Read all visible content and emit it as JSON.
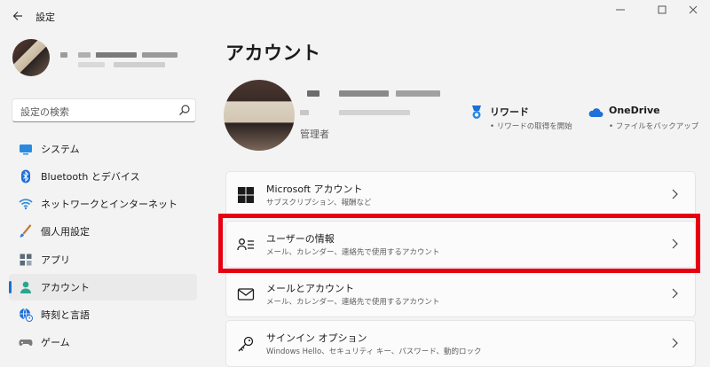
{
  "window": {
    "title": "設定",
    "back_icon": "arrow-left-icon",
    "controls": [
      "minimize-icon",
      "maximize-icon",
      "close-icon"
    ]
  },
  "sidebar": {
    "search": {
      "placeholder": "設定の検索",
      "icon": "search-icon"
    },
    "items": [
      {
        "label": "システム",
        "icon": "monitor-icon",
        "color": "#2a8ae0"
      },
      {
        "label": "Bluetooth とデバイス",
        "icon": "bluetooth-icon",
        "color": "#1e6fd9"
      },
      {
        "label": "ネットワークとインターネット",
        "icon": "wifi-icon",
        "color": "#2a8ae0"
      },
      {
        "label": "個人用設定",
        "icon": "brush-icon",
        "color": "#c27a3a"
      },
      {
        "label": "アプリ",
        "icon": "apps-icon",
        "color": "#5b6a7a"
      },
      {
        "label": "アカウント",
        "icon": "person-icon",
        "color": "#2ca58d",
        "active": true
      },
      {
        "label": "時刻と言語",
        "icon": "globe-clock-icon",
        "color": "#1e6fd9"
      },
      {
        "label": "ゲーム",
        "icon": "gamepad-icon",
        "color": "#7a7a7a"
      }
    ]
  },
  "main": {
    "title": "アカウント",
    "profile": {
      "role": "管理者"
    },
    "services": [
      {
        "title": "リワード",
        "subtitle": "• リワードの取得を開始",
        "icon": "rewards-icon"
      },
      {
        "title": "OneDrive",
        "subtitle": "• ファイルをバックアップ",
        "icon": "cloud-icon"
      }
    ],
    "cards": [
      {
        "title": "Microsoft アカウント",
        "subtitle": "サブスクリプション、報酬など",
        "icon": "windows-logo-icon"
      },
      {
        "title": "ユーザーの情報",
        "subtitle": "メール、カレンダー、連絡先で使用するアカウント",
        "icon": "user-info-icon",
        "highlighted": true
      },
      {
        "title": "メールとアカウント",
        "subtitle": "メール、カレンダー、連絡先で使用するアカウント",
        "icon": "mail-icon"
      },
      {
        "title": "サインイン オプション",
        "subtitle": "Windows Hello、セキュリティ キー、パスワード、動的ロック",
        "icon": "key-icon"
      }
    ]
  },
  "colors": {
    "accent": "#1a73c4",
    "highlight_border": "#e60012"
  }
}
